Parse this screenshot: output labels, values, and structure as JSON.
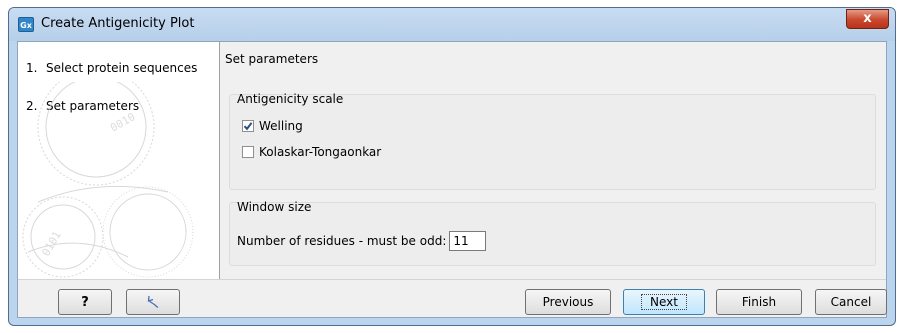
{
  "window": {
    "title": "Create Antigenicity Plot",
    "app_icon_text": "Gx",
    "close_label": "x"
  },
  "steps": [
    {
      "number": "1.",
      "label": "Select protein sequences"
    },
    {
      "number": "2.",
      "label": "Set parameters"
    }
  ],
  "panel": {
    "title": "Set parameters",
    "antigenicity_scale": {
      "label": "Antigenicity scale",
      "options": [
        {
          "label": "Welling",
          "checked": true
        },
        {
          "label": "Kolaskar-Tongaonkar",
          "checked": false
        }
      ]
    },
    "window_size": {
      "label": "Window size",
      "field_label": "Number of residues - must be odd:",
      "value": "11"
    }
  },
  "buttons": {
    "help": "?",
    "previous": "Previous",
    "next": "Next",
    "finish": "Finish",
    "cancel": "Cancel"
  }
}
